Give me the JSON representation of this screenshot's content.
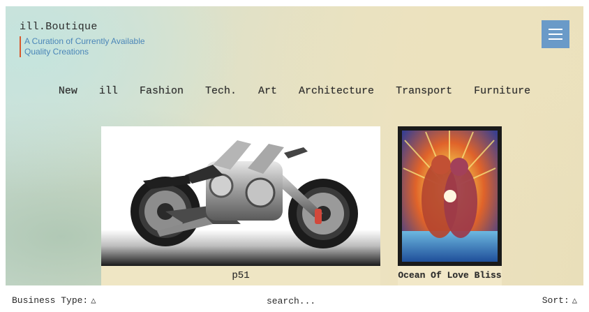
{
  "header": {
    "brand": "ill.Boutique",
    "tagline": "A Curation of Currently Available Quality Creations",
    "menu_icon": "hamburger-menu-icon"
  },
  "nav": {
    "items": [
      "New",
      "ill",
      "Fashion",
      "Tech.",
      "Art",
      "Architecture",
      "Transport",
      "Furniture"
    ]
  },
  "products": [
    {
      "title": "p51",
      "image": "motorcycle-photo"
    },
    {
      "title": "Ocean Of Love Bliss",
      "image": "psychedelic-painting"
    }
  ],
  "bottom_bar": {
    "business_type_label": "Business Type:",
    "search_placeholder": "search...",
    "sort_label": "Sort:",
    "dropdown_icon": "triangle-up-icon"
  },
  "colors": {
    "accent": "#d8572a",
    "tagline": "#4b86b8",
    "menu_button": "#6a9ac8"
  }
}
